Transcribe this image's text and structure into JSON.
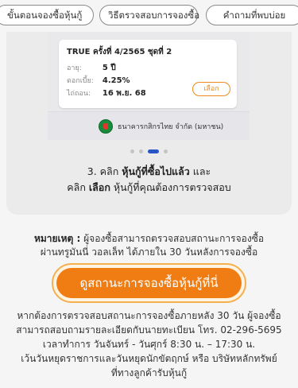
{
  "tabs": [
    {
      "label": "ขั้นตอนจองซื้อหุ้นกู้"
    },
    {
      "label": "วิธีตรวจสอบการจองซื้อ"
    },
    {
      "label": "คำถามที่พบบ่อย"
    }
  ],
  "screenshot": {
    "bond_title": "TRUE ครั้งที่ 4/2565 ชุดที่ 2",
    "rows": [
      {
        "label": "อายุ:",
        "value": "5 ปี"
      },
      {
        "label": "ดอกเบี้ย:",
        "value": "4.25%"
      },
      {
        "label": "ไถ่ถอน:",
        "value": "16 พ.ย. 68"
      }
    ],
    "select_label": "เลือก",
    "bank_name": "ธนาคารกสิกรไทย จำกัด (มหาชน)"
  },
  "carousel": {
    "count": 4,
    "active": 3
  },
  "step": {
    "line1_prefix": "3. คลิก ",
    "line1_bold": "หุ้นกู้ที่ซื้อไปแล้ว",
    "line1_suffix": " และ",
    "line2_prefix": "คลิก ",
    "line2_bold": "เลือก",
    "line2_suffix": " หุ้นกู้ที่คุณต้องการตรวจสอบ"
  },
  "note": {
    "label": "หมายเหตุ :",
    "line1": " ผู้จองซื้อสามารถตรวจสอบสถานะการจองซื้อ",
    "line2": "ผ่านทรูมันนี่ วอลเล็ท ได้ภายใน 30 วันหลังการจองซื้อ"
  },
  "cta_label": "ดูสถานะการจองซื้อหุ้นกู้ที่นี่",
  "info": [
    "หากต้องการตรวจสอบสถานะการจองซื้อภายหลัง 30 วัน ผู้จองซื้อ",
    "สามารถสอบถามรายละเอียดกับนายทะเบียน โทร. 02-296-5695",
    "เวลาทำการ วันจันทร์ - วันศุกร์ 8:30 น. – 17:30 น.",
    "เว้นวันหยุดราชการและวันหยุดนักขัตฤกษ์ หรือ บริษัทหลักทรัพย์",
    "ที่ทางลูกค้ารับหุ้นกู้"
  ],
  "colors": {
    "accent": "#f07d14",
    "dot_active": "#2a55c7",
    "bank_green": "#1a8a3d"
  }
}
